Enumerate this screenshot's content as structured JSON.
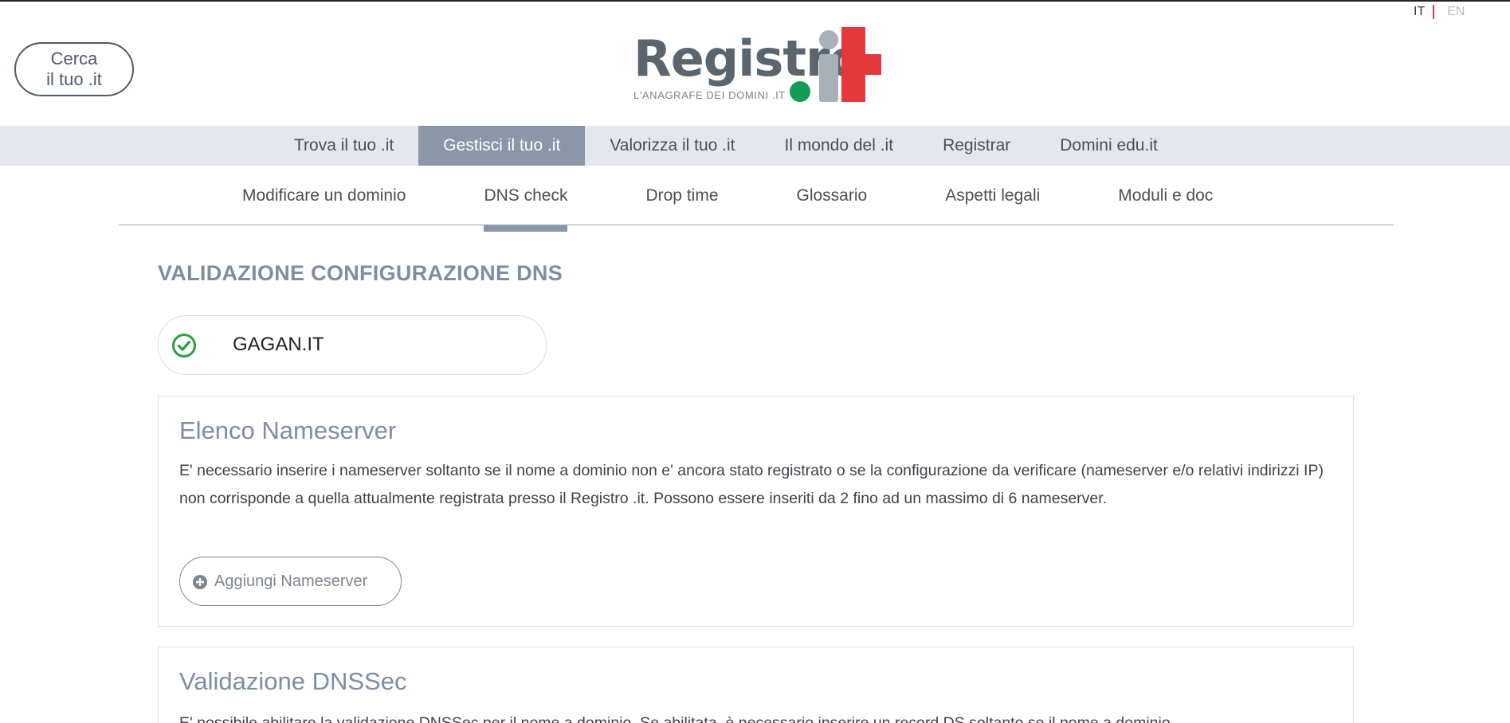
{
  "header": {
    "search_line1": "Cerca",
    "search_line2": "il tuo .it",
    "lang_it": "IT",
    "lang_en": "EN",
    "logo_word": "Registro",
    "logo_tagline": "L'ANAGRAFE DEI DOMINI .IT"
  },
  "main_nav": {
    "items": [
      {
        "label": "Trova il tuo .it"
      },
      {
        "label": "Gestisci il tuo .it",
        "active": true
      },
      {
        "label": "Valorizza il tuo .it"
      },
      {
        "label": "Il mondo del .it"
      },
      {
        "label": "Registrar"
      },
      {
        "label": "Domini edu.it"
      }
    ]
  },
  "sub_nav": {
    "items": [
      {
        "label": "Modificare un dominio"
      },
      {
        "label": "DNS check",
        "active": true
      },
      {
        "label": "Drop time"
      },
      {
        "label": "Glossario"
      },
      {
        "label": "Aspetti legali"
      },
      {
        "label": "Moduli e doc"
      }
    ]
  },
  "content": {
    "title": "VALIDAZIONE CONFIGURAZIONE DNS",
    "domain": {
      "name": "GAGAN.IT",
      "status_icon": "check-circle-icon"
    },
    "nameserver_panel": {
      "title": "Elenco Nameserver",
      "text": "E' necessario inserire i nameserver soltanto se il nome a dominio non e' ancora stato registrato o se la configurazione da verificare (nameserver e/o relativi indirizzi IP) non corrisponde a quella attualmente registrata presso il Registro .it. Possono essere inseriti da 2 fino ad un massimo di 6 nameserver.",
      "add_button": "Aggiungi Nameserver"
    },
    "dnssec_panel": {
      "title": "Validazione DNSSec",
      "text": "E' possibile abilitare la validazione DNSSec per il nome a dominio. Se abilitata, è necessario inserire un record DS soltanto se il nome a dominio"
    }
  },
  "colors": {
    "accent": "#8a97a8",
    "title": "#7d8da3",
    "nav_bg": "#e4e7ee",
    "success": "#2e9e3e",
    "logo_red": "#e5383b",
    "logo_green": "#0f9d58"
  }
}
